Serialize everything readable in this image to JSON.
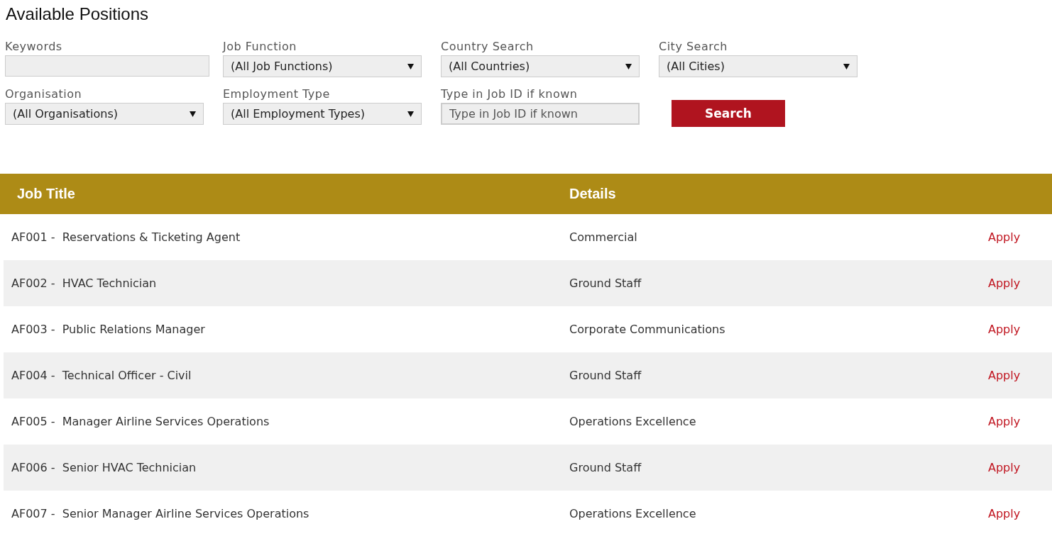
{
  "page_title": "Available Positions",
  "filters": [
    {
      "kind": "text",
      "label": "Keywords"
    },
    {
      "kind": "select",
      "label": "Job Function",
      "value": "(All Job Functions)"
    },
    {
      "kind": "select",
      "label": "Country Search",
      "value": "(All Countries)"
    },
    {
      "kind": "select",
      "label": "City Search",
      "value": "(All Cities)"
    },
    {
      "kind": "select",
      "label": "Organisation",
      "value": "(All Organisations)"
    },
    {
      "kind": "select",
      "label": "Employment Type",
      "value": "(All Employment Types)"
    },
    {
      "kind": "text",
      "label": "Type in Job ID if known",
      "placeholder": "Type in Job ID if known"
    }
  ],
  "search_button": "Search",
  "table": {
    "columns": [
      "Job Title",
      "Details"
    ],
    "rows": [
      {
        "title": "AF001 -  Reservations & Ticketing Agent",
        "details": "Commercial",
        "action": "Apply"
      },
      {
        "title": "AF002 -  HVAC Technician",
        "details": "Ground Staff",
        "action": "Apply"
      },
      {
        "title": "AF003 -  Public Relations Manager",
        "details": "Corporate Communications",
        "action": "Apply"
      },
      {
        "title": "AF004 -  Technical Officer - Civil",
        "details": "Ground Staff",
        "action": "Apply"
      },
      {
        "title": "AF005 -  Manager Airline Services Operations",
        "details": "Operations Excellence",
        "action": "Apply"
      },
      {
        "title": "AF006 -  Senior HVAC Technician",
        "details": "Ground Staff",
        "action": "Apply"
      },
      {
        "title": "AF007 -  Senior Manager Airline Services Operations",
        "details": "Operations Excellence",
        "action": "Apply"
      }
    ]
  }
}
